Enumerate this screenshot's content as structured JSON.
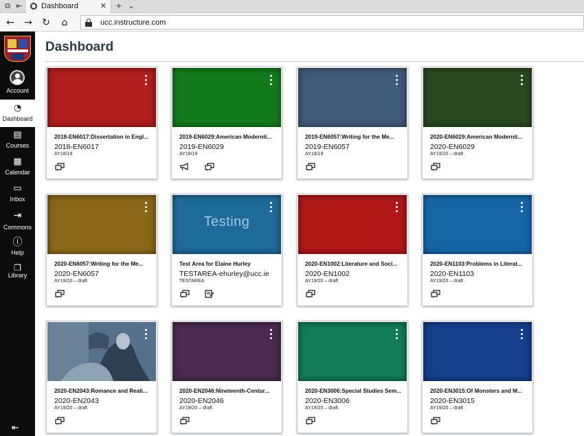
{
  "browser": {
    "tab_title": "Dashboard",
    "url": "ucc.instructure.com",
    "icons": [
      "window-tile-icon",
      "back-tab-icon",
      "favicon-icon",
      "close-icon",
      "new-tab-icon",
      "tab-menu-icon",
      "back-arrow-icon",
      "forward-arrow-icon",
      "refresh-icon",
      "home-icon",
      "lock-icon"
    ]
  },
  "globalnav": {
    "items": [
      {
        "label": "Account",
        "icon": "avatar-icon"
      },
      {
        "label": "Dashboard",
        "icon": "dashboard-icon",
        "active": true
      },
      {
        "label": "Courses",
        "icon": "courses-icon"
      },
      {
        "label": "Calendar",
        "icon": "calendar-icon"
      },
      {
        "label": "Inbox",
        "icon": "inbox-icon"
      },
      {
        "label": "Commons",
        "icon": "commons-icon"
      },
      {
        "label": "Help",
        "icon": "help-icon"
      },
      {
        "label": "Library",
        "icon": "library-icon"
      }
    ]
  },
  "page": {
    "title": "Dashboard"
  },
  "cards": [
    {
      "name": "2018-EN6017:Dissertation in Engl...",
      "code": "2018-EN6017",
      "term": "AY18/19",
      "color": "#b01d1d",
      "actions": [
        "discussions-icon"
      ]
    },
    {
      "name": "2019-EN6029:American Modernit...",
      "code": "2019-EN6029",
      "term": "AY18/19",
      "color": "#137a1c",
      "actions": [
        "announcements-icon",
        "discussions-icon"
      ]
    },
    {
      "name": "2019-EN6057:Writing for the Me...",
      "code": "2019-EN6057",
      "term": "AY18/19",
      "color": "#405a7c",
      "actions": [
        "discussions-icon"
      ]
    },
    {
      "name": "2020-EN6029:American Modernit...",
      "code": "2020-EN6029",
      "term": "AY19/20 – draft",
      "color": "#29481f",
      "actions": [
        "discussions-icon"
      ]
    },
    {
      "name": "2020-EN6057:Writing for the Me...",
      "code": "2020-EN6057",
      "term": "AY19/20 – draft",
      "color": "#8a6718",
      "actions": [
        "discussions-icon"
      ]
    },
    {
      "name": "Test Area for Elaine Hurley",
      "code": "TESTAREA-ehurley@ucc.ie",
      "term": "TESTAREA",
      "color": "#1e6a98",
      "hero_text": "Testing",
      "actions": [
        "discussions-icon",
        "assignments-icon"
      ]
    },
    {
      "name": "2020-EN1002:Literature and Soci...",
      "code": "2020-EN1002",
      "term": "AY19/20 – draft",
      "color": "#b01818",
      "actions": [
        "discussions-icon"
      ]
    },
    {
      "name": "2020-EN1103:Problems in Literat...",
      "code": "2020-EN1103",
      "term": "AY19/20 – draft",
      "color": "#1765a7",
      "actions": [
        "discussions-icon"
      ]
    },
    {
      "name": "2020-EN2043:Romance and Reali...",
      "code": "2020-EN2043",
      "term": "AY19/20 – draft",
      "color": "#4e6a84",
      "image": "painting",
      "actions": [
        "discussions-icon"
      ]
    },
    {
      "name": "2020-EN2046:Nineteenth-Centur...",
      "code": "2020-EN2046",
      "term": "AY19/20 – draft",
      "color": "#4a2a4e",
      "actions": [
        "discussions-icon"
      ]
    },
    {
      "name": "2020-EN3006:Special Studies Sem...",
      "code": "2020-EN3006",
      "term": "AY19/20 – draft",
      "color": "#137a5a",
      "actions": [
        "discussions-icon"
      ]
    },
    {
      "name": "2020-EN3015:Of Monsters and M...",
      "code": "2020-EN3015",
      "term": "AY19/20 – draft",
      "color": "#153e8c",
      "actions": [
        "discussions-icon"
      ]
    }
  ]
}
